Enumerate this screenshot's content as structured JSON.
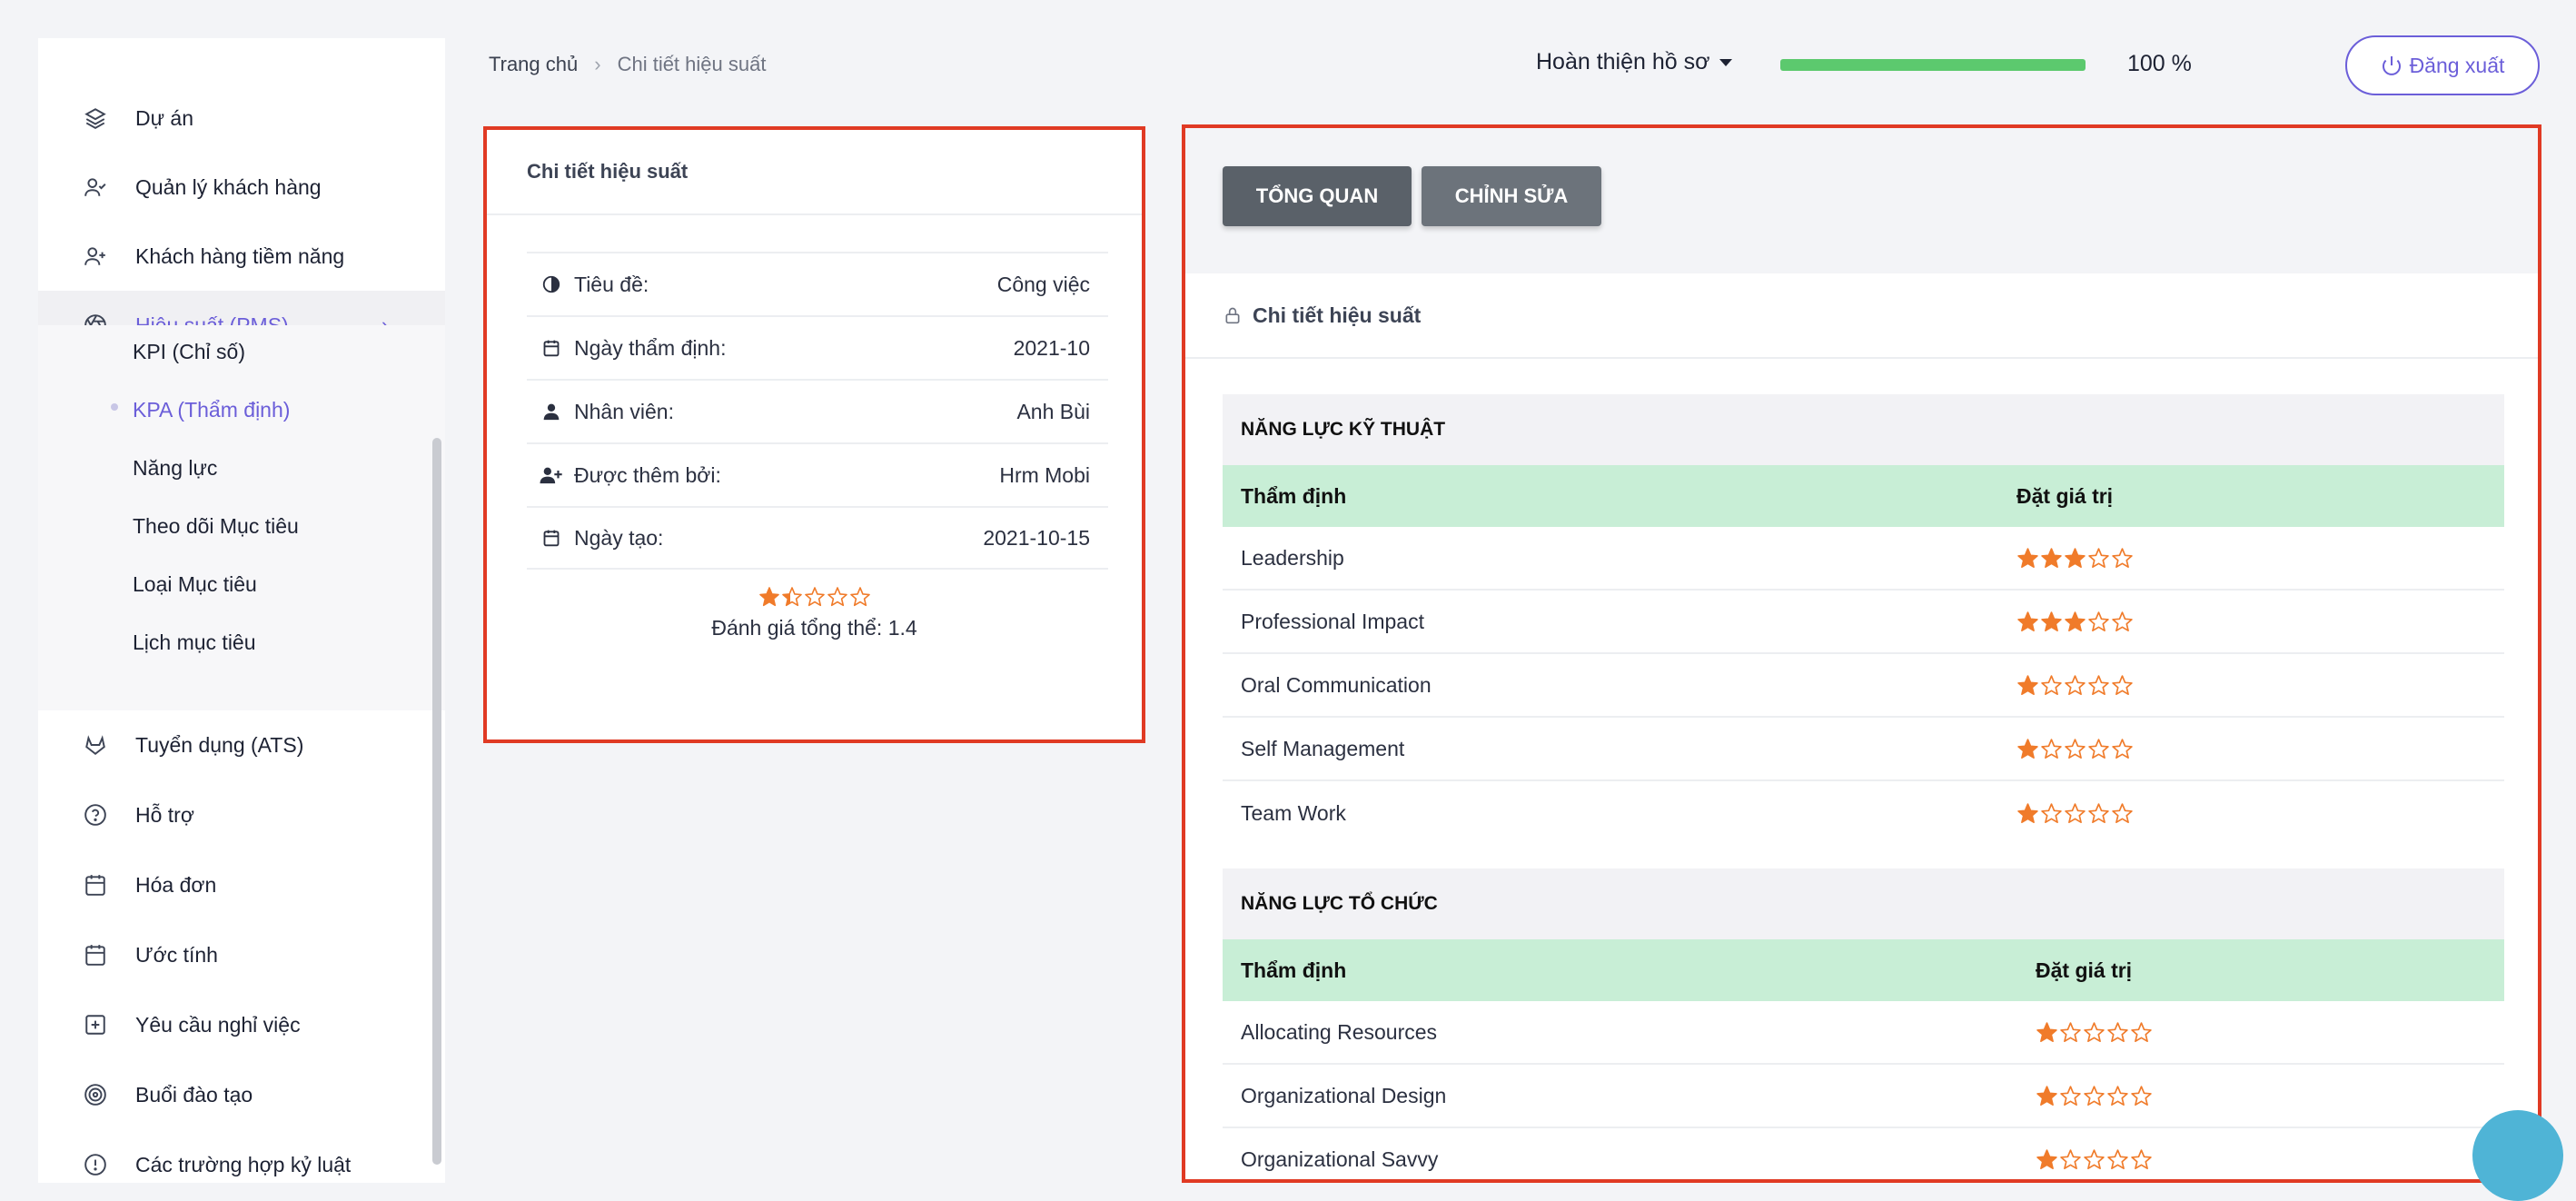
{
  "sidebar": {
    "items": [
      {
        "label": "Dự án",
        "icon": "layers-icon"
      },
      {
        "label": "Quản lý khách hàng",
        "icon": "user-check-icon"
      },
      {
        "label": "Khách hàng tiềm năng",
        "icon": "user-plus-icon"
      },
      {
        "label": "Hiệu suất (PMS)",
        "icon": "aperture-icon"
      },
      {
        "label": "Tuyển dụng (ATS)",
        "icon": "gitlab-icon"
      },
      {
        "label": "Hỗ trợ",
        "icon": "help-circle-icon"
      },
      {
        "label": "Hóa đơn",
        "icon": "calendar-icon"
      },
      {
        "label": "Ước tính",
        "icon": "calendar-icon"
      },
      {
        "label": "Yêu cầu nghỉ việc",
        "icon": "plus-square-icon"
      },
      {
        "label": "Buổi đào tạo",
        "icon": "target-icon"
      },
      {
        "label": "Các trường hợp kỷ luật",
        "icon": "alert-circle-icon"
      }
    ],
    "sub_items": [
      {
        "label": "KPI (Chỉ số)"
      },
      {
        "label": "KPA (Thẩm định)"
      },
      {
        "label": "Năng lực"
      },
      {
        "label": "Theo dõi Mục tiêu"
      },
      {
        "label": "Loại Mục tiêu"
      },
      {
        "label": "Lịch mục tiêu"
      }
    ]
  },
  "header": {
    "breadcrumb_home": "Trang chủ",
    "breadcrumb_current": "Chi tiết hiệu suất",
    "profile_dropdown": "Hoàn thiện hồ sơ",
    "progress_value": 1.0,
    "progress_text": "100 %",
    "logout_label": "Đăng xuất"
  },
  "summary": {
    "title": "Chi tiết hiệu suất",
    "rows": [
      {
        "label": "Tiêu đề:",
        "value": "Công việc",
        "icon": "contrast-icon"
      },
      {
        "label": "Ngày thẩm định:",
        "value": "2021-10",
        "icon": "calendar-icon"
      },
      {
        "label": "Nhân viên:",
        "value": "Anh Bùi",
        "icon": "user-icon"
      },
      {
        "label": "Được thêm bởi:",
        "value": "Hrm Mobi",
        "icon": "user-plus-icon"
      },
      {
        "label": "Ngày tạo:",
        "value": "2021-10-15",
        "icon": "calendar-icon"
      }
    ],
    "overall_rating": 1.4,
    "overall_text": "Đánh giá tổng thể: 1.4"
  },
  "detail": {
    "tab_overview": "TỔNG QUAN",
    "tab_edit": "CHỈNH SỬA",
    "section_title": "Chi tiết hiệu suất",
    "technical": {
      "title": "NĂNG LỰC KỸ THUẬT",
      "col_assess": "Thẩm định",
      "col_value": "Đặt giá trị",
      "rows": [
        {
          "name": "Leadership",
          "stars": 3
        },
        {
          "name": "Professional Impact",
          "stars": 3
        },
        {
          "name": "Oral Communication",
          "stars": 1
        },
        {
          "name": "Self Management",
          "stars": 1
        },
        {
          "name": "Team Work",
          "stars": 1
        }
      ]
    },
    "organizational": {
      "title": "NĂNG LỰC TỔ CHỨC",
      "col_assess": "Thẩm định",
      "col_value": "Đặt giá trị",
      "rows": [
        {
          "name": "Allocating Resources",
          "stars": 1
        },
        {
          "name": "Organizational Design",
          "stars": 1
        },
        {
          "name": "Organizational Savvy",
          "stars": 1
        }
      ]
    }
  },
  "colors": {
    "accent": "#6b5ed9",
    "star": "#f07b2a",
    "highlight": "#e03a24",
    "progress": "#5cc96e"
  }
}
